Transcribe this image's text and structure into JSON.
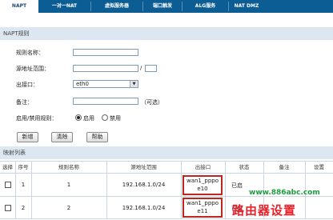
{
  "tabs": [
    {
      "label": "NAPT",
      "active": true
    },
    {
      "label": "一对一NAT",
      "active": false
    },
    {
      "label": "虚拟服务器",
      "active": false
    },
    {
      "label": "端口触发",
      "active": false
    },
    {
      "label": "ALG服务",
      "active": false
    },
    {
      "label": "NAT DMZ",
      "active": false
    }
  ],
  "napt_section": {
    "title": "NAPT规则"
  },
  "form": {
    "rule_name_label": "规则名称：",
    "rule_name_value": "",
    "src_range_label": "源地址范围：",
    "src_ip_value": "",
    "src_mask_value": "",
    "slash": "/",
    "out_iface_label": "出接口：",
    "out_iface_value": "eth0",
    "remark_label": "备注：",
    "remark_value": "",
    "optional_hint": "（可选）",
    "enable_label": "启用/禁用规则：",
    "enable_option": "启用",
    "disable_option": "禁用",
    "enabled": true
  },
  "buttons": {
    "add": "新增",
    "clear": "清除",
    "help": "帮助"
  },
  "mapping_section": {
    "title": "映射列表"
  },
  "table": {
    "headers": [
      "选择",
      "序号",
      "规则名称",
      "源地址范围",
      "出接口",
      "状态",
      "备注",
      "设置"
    ],
    "rows": [
      {
        "index": "1",
        "name": "1",
        "src": "192.168.1.0/24",
        "iface_line1": "wan1_pppo",
        "iface_line2": "e10",
        "status": "已启"
      },
      {
        "index": "2",
        "name": "2",
        "src": "192.168.1.0/24",
        "iface_line1": "wan1_pppo",
        "iface_line2": "e11",
        "status": "已启"
      }
    ]
  },
  "watermark": {
    "url": "www.886abc.com",
    "text": "路由器设置"
  },
  "colors": {
    "tab_bar": "#0c5d93",
    "section_bg": "#dde7f1",
    "highlight_border": "#c0261d"
  }
}
